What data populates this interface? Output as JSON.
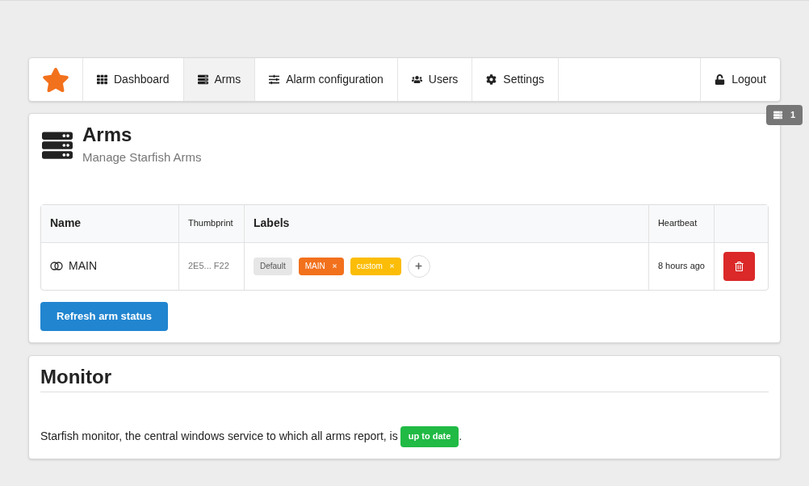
{
  "nav": {
    "items": [
      {
        "label": "Dashboard",
        "selected": false
      },
      {
        "label": "Arms",
        "selected": true
      },
      {
        "label": "Alarm configuration",
        "selected": false
      },
      {
        "label": "Users",
        "selected": false
      },
      {
        "label": "Settings",
        "selected": false
      }
    ],
    "logout": {
      "label": "Logout"
    }
  },
  "floating_badge": {
    "count": "1"
  },
  "arms": {
    "title": "Arms",
    "subtitle": "Manage Starfish Arms",
    "table": {
      "columns": [
        "Name",
        "Thumbprint",
        "Labels",
        "Heartbeat"
      ],
      "rows": [
        {
          "name": "MAIN",
          "thumbprint": "2E5... F22",
          "labels": [
            {
              "text": "Default",
              "color": "#e6e6e6",
              "removable": false
            },
            {
              "text": "MAIN",
              "color": "#f2711c",
              "removable": true
            },
            {
              "text": "custom",
              "color": "#fbbd08",
              "removable": true
            }
          ],
          "heartbeat": "8 hours ago"
        }
      ]
    },
    "refresh_button": "Refresh arm status"
  },
  "monitor": {
    "title": "Monitor",
    "text_before": "Starfish monitor, the central windows service to which all arms report, is",
    "status": "up to date",
    "text_after": "."
  }
}
